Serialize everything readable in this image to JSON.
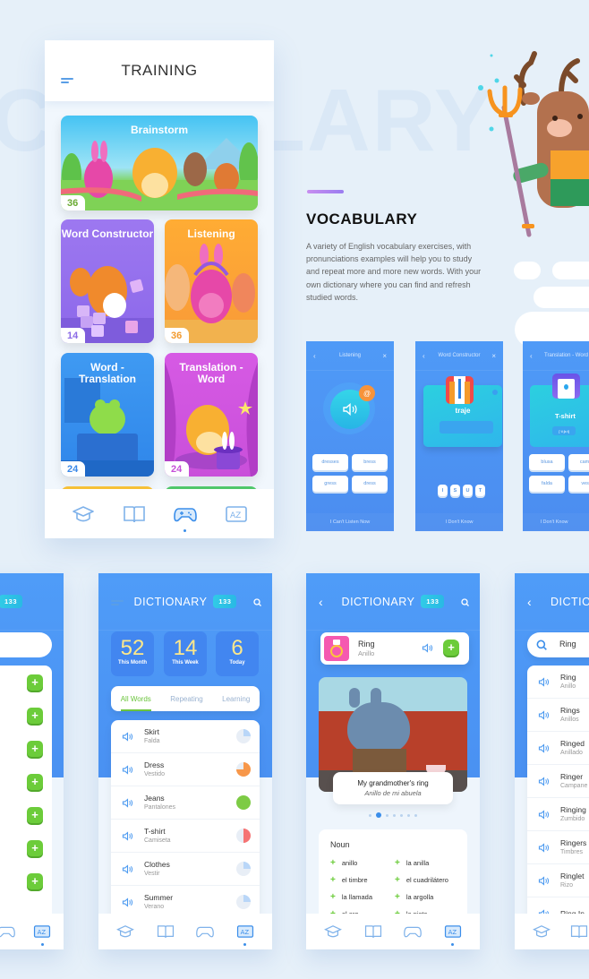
{
  "watermark": "CABULARY",
  "training": {
    "title": "TRAINING",
    "cards": [
      {
        "title": "Brainstorm",
        "count": "36",
        "count_color": "#6aaa32"
      },
      {
        "title": "Word Constructor",
        "count": "14",
        "count_color": "#8b6be6"
      },
      {
        "title": "Listening",
        "count": "36",
        "count_color": "#f29a2e"
      },
      {
        "title": "Word - Translation",
        "count": "24",
        "count_color": "#3a88e8"
      },
      {
        "title": "Translation - Word",
        "count": "24",
        "count_color": "#c54fd8"
      }
    ],
    "nav": [
      "graduation-cap",
      "book",
      "gamepad",
      "az-dictionary"
    ],
    "active_nav": "gamepad"
  },
  "vocabulary": {
    "title": "VOCABULARY",
    "description": "A variety of English vocabulary exercises, with pronunciations examples will help you to study and repeat more and more new words. With your own dictionary where you can find and refresh studied words."
  },
  "mini_screens": [
    {
      "title": "Listening",
      "options": [
        "dresses",
        "bress",
        "gress",
        "dress"
      ],
      "footer": "I Can't Listen Now"
    },
    {
      "title": "Word Constructor",
      "word": "traje",
      "letters": [
        "I",
        "S",
        "U",
        "T"
      ],
      "footer": "I Don't Know"
    },
    {
      "title": "Translation - Word",
      "word": "T-shirt",
      "transcription": "[ˈtiːʃɜːt]",
      "options": [
        "blusa",
        "camis",
        "falda",
        "vesti"
      ],
      "footer": "I Don't Know"
    }
  ],
  "dictionary_badge": "133",
  "dictionary_stats": {
    "title": "DICTIONARY",
    "stats": [
      {
        "value": "52",
        "label": "This Month"
      },
      {
        "value": "14",
        "label": "This Week"
      },
      {
        "value": "6",
        "label": "Today"
      }
    ],
    "tabs": [
      "All Words",
      "Repeating",
      "Learning"
    ],
    "active_tab": "All Words",
    "words": [
      {
        "word": "Skirt",
        "translation": "Falda",
        "progress": 0.25,
        "color": "#b9d6f8"
      },
      {
        "word": "Dress",
        "translation": "Vestido",
        "progress": 0.75,
        "color": "#f7974a"
      },
      {
        "word": "Jeans",
        "translation": "Pantalones",
        "progress": 1.0,
        "color": "#7dcb45"
      },
      {
        "word": "T-shirt",
        "translation": "Camiseta",
        "progress": 0.5,
        "color": "#f57474"
      },
      {
        "word": "Clothes",
        "translation": "Vestir",
        "progress": 0.25,
        "color": "#b9d6f8"
      },
      {
        "word": "Summer",
        "translation": "Verano",
        "progress": 0.25,
        "color": "#b9d6f8"
      }
    ]
  },
  "dictionary_detail": {
    "title": "DICTIONARY",
    "word": "Ring",
    "translation": "Anillo",
    "example": "My grandmother's ring",
    "example_translation": "Anillo de mi abuela",
    "carousel_pages": 7,
    "carousel_active": 2,
    "part_of_speech": "Noun",
    "translations": [
      "anillo",
      "la anilla",
      "el timbre",
      "el cuadrilátero",
      "la llamada",
      "la argolla",
      "el aro",
      "la pista"
    ]
  },
  "dictionary_search": {
    "title": "DICTIO",
    "query": "Ring",
    "results": [
      {
        "word": "Ring",
        "translation": "Anillo"
      },
      {
        "word": "Rings",
        "translation": "Anillos"
      },
      {
        "word": "Ringed",
        "translation": "Anillado"
      },
      {
        "word": "Ringer",
        "translation": "Campane"
      },
      {
        "word": "Ringing",
        "translation": "Zumbido"
      },
      {
        "word": "Ringers",
        "translation": "Timbres"
      },
      {
        "word": "Ringlet",
        "translation": "Rizo"
      },
      {
        "word": "Ring In",
        "translation": ""
      }
    ]
  },
  "colors": {
    "primary_blue": "#4a93f3",
    "green": "#6ccc3a",
    "stat_yellow": "#fde88b"
  }
}
